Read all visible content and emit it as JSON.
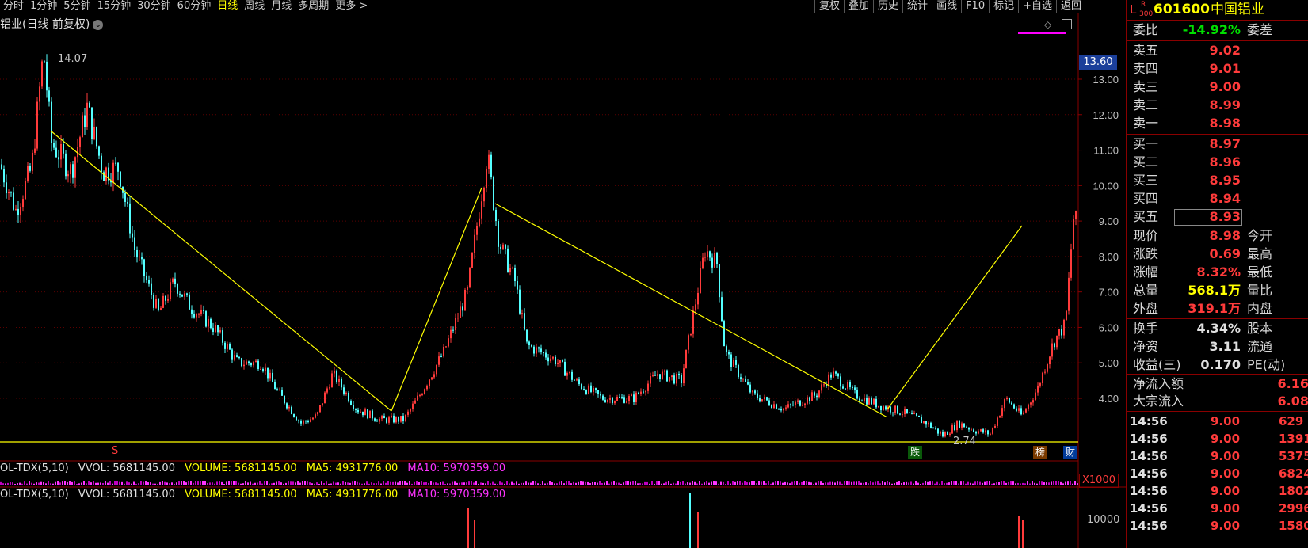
{
  "toolbar": {
    "period_tabs": [
      "分时",
      "1分钟",
      "5分钟",
      "15分钟",
      "30分钟",
      "60分钟",
      "日线",
      "周线",
      "月线",
      "多周期",
      "更多 >"
    ],
    "active_tab": "日线",
    "right_tools": [
      "复权",
      "叠加",
      "历史",
      "统计",
      "画线",
      "F10",
      "标记",
      "+自选",
      "返回"
    ]
  },
  "chart": {
    "title": "铝业(日线 前复权)",
    "y_ticks": [
      "13.00",
      "12.00",
      "11.00",
      "10.00",
      "9.00",
      "8.00",
      "7.00",
      "6.00",
      "5.00",
      "4.00"
    ],
    "current_price_tag": "13.60",
    "high_label": "14.07",
    "low_label": "2.74",
    "markers": {
      "s_marker": "S",
      "die": "跌",
      "bang": "榜",
      "cai": "财"
    },
    "colors": {
      "up": "#ff3b3b",
      "down": "#54ffff",
      "trendline": "#ffff00",
      "support": "#ffff00"
    }
  },
  "volume1": {
    "labels": [
      "OL-TDX(5,10)",
      "VVOL: 5681145.00",
      "VOLUME: 5681145.00",
      "MA5: 4931776.00",
      "MA10: 5970359.00"
    ],
    "scale": "X1000"
  },
  "volume2": {
    "labels": [
      "OL-TDX(5,10)",
      "VVOL: 5681145.00",
      "VOLUME: 5681145.00",
      "MA5: 4931776.00",
      "MA10: 5970359.00"
    ],
    "tick": "10000"
  },
  "quote": {
    "prefix": "L",
    "prefix_sup": "R",
    "prefix_sub": "300",
    "code": "601600",
    "name": "中国铝业",
    "weibi_label": "委比",
    "weibi_value": "-14.92%",
    "weicha_label": "委差",
    "asks": [
      {
        "label": "卖五",
        "price": "9.02"
      },
      {
        "label": "卖四",
        "price": "9.01"
      },
      {
        "label": "卖三",
        "price": "9.00"
      },
      {
        "label": "卖二",
        "price": "8.99"
      },
      {
        "label": "卖一",
        "price": "8.98"
      }
    ],
    "bids": [
      {
        "label": "买一",
        "price": "8.97"
      },
      {
        "label": "买二",
        "price": "8.96"
      },
      {
        "label": "买三",
        "price": "8.95"
      },
      {
        "label": "买四",
        "price": "8.94"
      },
      {
        "label": "买五",
        "price": "8.93"
      }
    ],
    "stats": [
      {
        "label": "现价",
        "value": "8.98",
        "label2": "今开",
        "color": "red"
      },
      {
        "label": "涨跌",
        "value": "0.69",
        "label2": "最高",
        "color": "red"
      },
      {
        "label": "涨幅",
        "value": "8.32%",
        "label2": "最低",
        "color": "red"
      },
      {
        "label": "总量",
        "value": "568.1万",
        "label2": "量比",
        "color": "yel"
      },
      {
        "label": "外盘",
        "value": "319.1万",
        "label2": "内盘",
        "color": "red"
      }
    ],
    "stats2": [
      {
        "label": "换手",
        "value": "4.34%",
        "label2": "股本",
        "color": "wht"
      },
      {
        "label": "净资",
        "value": "3.11",
        "label2": "流通",
        "color": "wht"
      },
      {
        "label": "收益(三)",
        "value": "0.170",
        "label2": "PE(动)",
        "color": "wht"
      }
    ],
    "flows": [
      {
        "label": "净流入额",
        "value": "6.16"
      },
      {
        "label": "大宗流入",
        "value": "6.08"
      }
    ],
    "ticks": [
      {
        "time": "14:56",
        "price": "9.00",
        "vol": "629"
      },
      {
        "time": "14:56",
        "price": "9.00",
        "vol": "1391"
      },
      {
        "time": "14:56",
        "price": "9.00",
        "vol": "5375"
      },
      {
        "time": "14:56",
        "price": "9.00",
        "vol": "6824"
      },
      {
        "time": "14:56",
        "price": "9.00",
        "vol": "1802"
      },
      {
        "time": "14:56",
        "price": "9.00",
        "vol": "2996"
      },
      {
        "time": "14:56",
        "price": "9.00",
        "vol": "1580"
      }
    ]
  }
}
